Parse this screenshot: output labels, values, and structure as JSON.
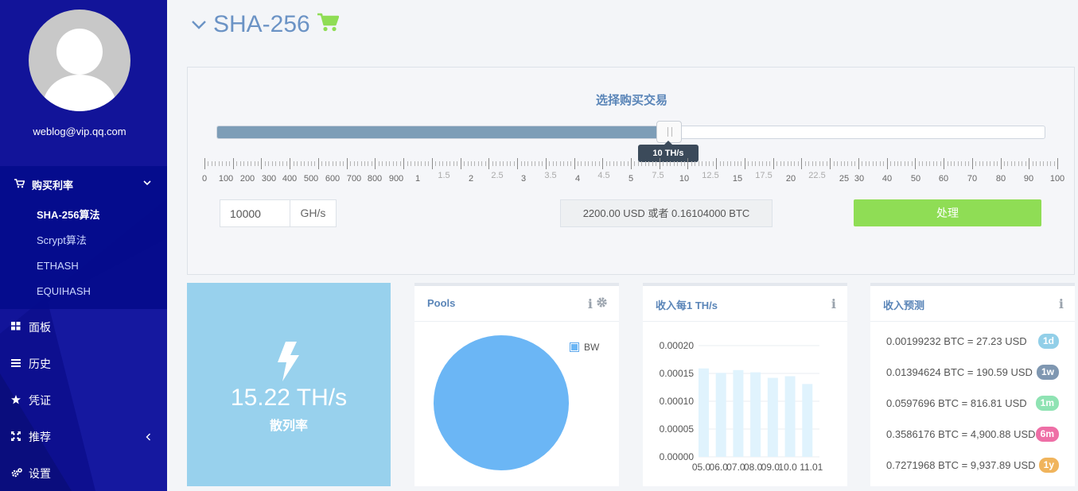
{
  "sidebar": {
    "email": "weblog@vip.qq.com",
    "section_title": "购买利率",
    "sub_items": [
      "SHA-256算法",
      "Scrypt算法",
      "ETHASH",
      "EQUIHASH"
    ],
    "nav": {
      "dashboard": "面板",
      "history": "历史",
      "voucher": "凭证",
      "referral": "推荐",
      "settings": "设置"
    }
  },
  "header": {
    "title": "SHA-256"
  },
  "purchase": {
    "title": "选择购买交易",
    "slider_value": 0.5,
    "tooltip": "10 TH/s",
    "ruler_labels": {
      "dark": [
        "0",
        "100",
        "200",
        "300",
        "400",
        "500",
        "600",
        "700",
        "800",
        "900",
        "1",
        "2",
        "3",
        "4",
        "5",
        "10",
        "15",
        "20",
        "25",
        "30",
        "40",
        "50",
        "60",
        "70",
        "80",
        "90",
        "100"
      ],
      "light": [
        "1.5",
        "2.5",
        "3.5",
        "4.5",
        "7.5",
        "12.5",
        "17.5",
        "22.5"
      ]
    },
    "input_value": "10000",
    "unit": "GH/s",
    "price": "2200.00 USD 或者 0.16104000 BTC",
    "button": "处理"
  },
  "hashrate": {
    "value": "15.22 TH/s",
    "label": "散列率"
  },
  "pools": {
    "title": "Pools",
    "legend": "BW"
  },
  "chart_data": {
    "type": "bar",
    "title": "收入每1 TH/s",
    "categories": [
      "05.0",
      "06.0",
      "07.0",
      "08.0",
      "09.0",
      "10.0",
      "11.01"
    ],
    "values": [
      0.000159,
      0.000151,
      0.000156,
      0.000152,
      0.000142,
      0.000145,
      0.000131
    ],
    "yticks": [
      "0.00020",
      "0.00015",
      "0.00010",
      "0.00005",
      "0.00000"
    ],
    "ylim": [
      0,
      0.0002
    ],
    "grid": true
  },
  "forecast": {
    "title": "收入预测",
    "rows": [
      {
        "text": "0.00199232 BTC = 27.23 USD",
        "badge": "1d",
        "color": "#92cfe8"
      },
      {
        "text": "0.01394624 BTC = 190.59 USD",
        "badge": "1w",
        "color": "#7f97b1"
      },
      {
        "text": "0.0597696 BTC = 816.81 USD",
        "badge": "1m",
        "color": "#8fe3b3"
      },
      {
        "text": "0.3586176 BTC = 4,900.88 USD",
        "badge": "6m",
        "color": "#ee6fa6"
      },
      {
        "text": "0.7271968 BTC = 9,937.89 USD",
        "badge": "1y",
        "color": "#f0b45c"
      }
    ]
  },
  "colors": {
    "sidebar": "#0d0f8f",
    "accent": "#6b93c5",
    "cart": "#8fdd55",
    "hash_card": "#98d1ed",
    "pie": "#6bb6f5",
    "bar": "#e0f3fd"
  }
}
